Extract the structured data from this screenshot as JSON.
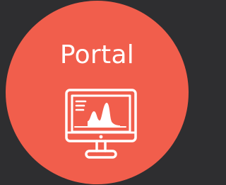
{
  "tile": {
    "label": "Portal",
    "icon": "monitor-chart-icon",
    "background_color": "#f15e4c",
    "icon_color": "#ffffff"
  },
  "page": {
    "background_color": "#2e2e30"
  }
}
